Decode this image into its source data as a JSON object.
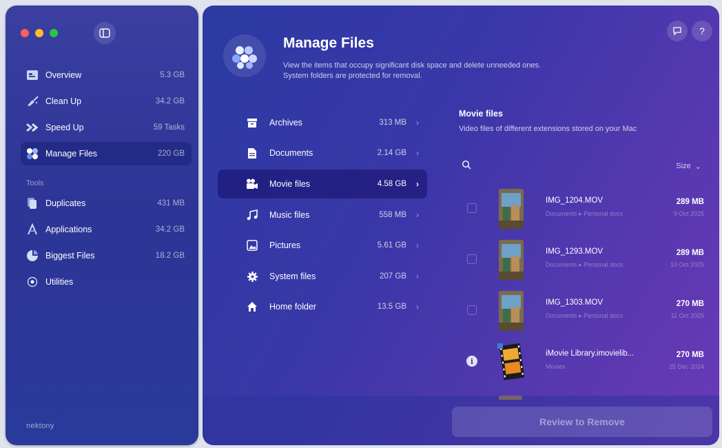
{
  "sidebar": {
    "main_items": [
      {
        "label": "Overview",
        "value": "5.3 GB",
        "icon": "overview-icon"
      },
      {
        "label": "Clean Up",
        "value": "34.2 GB",
        "icon": "broom-icon"
      },
      {
        "label": "Speed Up",
        "value": "59 Tasks",
        "icon": "speed-chevrons-icon"
      },
      {
        "label": "Manage Files",
        "value": "220 GB",
        "icon": "manage-files-icon"
      }
    ],
    "tools_heading": "Tools",
    "tool_items": [
      {
        "label": "Duplicates",
        "value": "431 MB",
        "icon": "duplicates-icon"
      },
      {
        "label": "Applications",
        "value": "34.2 GB",
        "icon": "applications-icon"
      },
      {
        "label": "Biggest Files",
        "value": "18.2 GB",
        "icon": "biggest-files-icon"
      },
      {
        "label": "Utilities",
        "value": "",
        "icon": "utilities-icon"
      }
    ],
    "brand": "nektony"
  },
  "header": {
    "title": "Manage Files",
    "description_line1": "View the items that occupy significant disk space and delete unneeded ones.",
    "description_line2": "System folders are protected for removal."
  },
  "categories": [
    {
      "label": "Archives",
      "size": "313 MB",
      "icon": "archive-icon"
    },
    {
      "label": "Documents",
      "size": "2.14 GB",
      "icon": "document-icon"
    },
    {
      "label": "Movie files",
      "size": "4.58 GB",
      "icon": "movie-icon"
    },
    {
      "label": "Music files",
      "size": "558 MB",
      "icon": "music-icon"
    },
    {
      "label": "Pictures",
      "size": "5.61 GB",
      "icon": "picture-icon"
    },
    {
      "label": "System files",
      "size": "207 GB",
      "icon": "gear-icon"
    },
    {
      "label": "Home folder",
      "size": "13.5 GB",
      "icon": "home-icon"
    }
  ],
  "active_category": "Movie files",
  "detail": {
    "title": "Movie files",
    "subtitle": "Video files of different extensions stored on your Mac",
    "sort_label": "Size",
    "files": [
      {
        "name": "IMG_1204.MOV",
        "path_a": "Documents",
        "path_b": "Personal docs",
        "size": "289 MB",
        "date": "9 Oct 2025"
      },
      {
        "name": "IMG_1293.MOV",
        "path_a": "Documents",
        "path_b": "Personal docs",
        "size": "289 MB",
        "date": "10 Oct 2025"
      },
      {
        "name": "IMG_1303.MOV",
        "path_a": "Documents",
        "path_b": "Personal docs",
        "size": "270 MB",
        "date": "11 Oct 2025"
      },
      {
        "name": "iMovie Library.imovielib...",
        "path_a": "Movies",
        "path_b": "",
        "size": "270 MB",
        "date": "25 Dec 2024"
      }
    ]
  },
  "footer": {
    "review_label": "Review to Remove"
  },
  "colors": {
    "accent": "#2d3596",
    "active_row": "#1e1978"
  }
}
